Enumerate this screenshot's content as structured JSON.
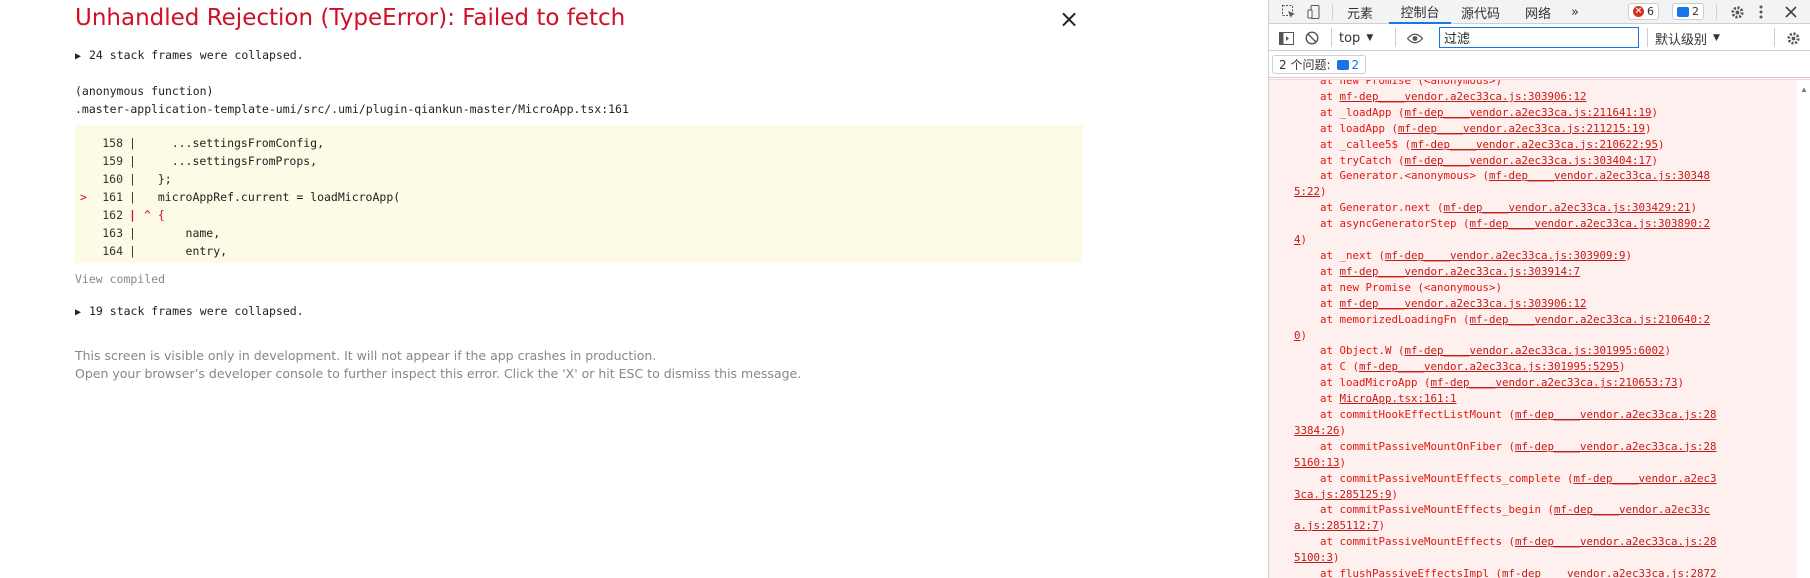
{
  "overlay": {
    "title": "Unhandled Rejection (TypeError): Failed to fetch",
    "close_glyph": "×",
    "collapsed_top": "24 stack frames were collapsed.",
    "function_name": "(anonymous function)",
    "file_path": ".master-application-template-umi/src/.umi/plugin-qiankun-master/MicroApp.tsx:161",
    "code_lines": [
      {
        "num": "158",
        "code": "    ...settingsFromConfig,",
        "highlight": false,
        "marker": ""
      },
      {
        "num": "159",
        "code": "    ...settingsFromProps,",
        "highlight": false,
        "marker": ""
      },
      {
        "num": "160",
        "code": "  };",
        "highlight": false,
        "marker": ""
      },
      {
        "num": "161",
        "code": "  microAppRef.current = loadMicroApp(",
        "highlight": true,
        "marker": ">"
      },
      {
        "num": "162",
        "code": "^ {",
        "highlight": true,
        "marker": ""
      },
      {
        "num": "163",
        "code": "      name,",
        "highlight": false,
        "marker": ""
      },
      {
        "num": "164",
        "code": "      entry,",
        "highlight": false,
        "marker": ""
      }
    ],
    "view_compiled": "View compiled",
    "collapsed_bottom": "19 stack frames were collapsed.",
    "footer_line1": "This screen is visible only in development. It will not appear if the app crashes in production.",
    "footer_line2": "Open your browser’s developer console to further inspect this error.  Click the 'X' or hit ESC to dismiss this message."
  },
  "devtools": {
    "tabs": {
      "elements": "元素",
      "console": "控制台",
      "sources": "源代码",
      "network": "网络",
      "more": "»"
    },
    "error_count": "6",
    "message_count": "2",
    "context": "top",
    "filter_value": "过滤",
    "levels": "默认级别",
    "issues_label": "2 个问题:",
    "issues_count": "2",
    "console_lines": [
      {
        "pre": "    at new Promise (<anonymous>)",
        "link": "",
        "post": ""
      },
      {
        "pre": "    at ",
        "link": "mf-dep____vendor.a2ec33ca.js:303906:12",
        "post": ""
      },
      {
        "pre": "    at _loadApp (",
        "link": "mf-dep____vendor.a2ec33ca.js:211641:19",
        "post": ")"
      },
      {
        "pre": "    at loadApp (",
        "link": "mf-dep____vendor.a2ec33ca.js:211215:19",
        "post": ")"
      },
      {
        "pre": "    at _callee5$ (",
        "link": "mf-dep____vendor.a2ec33ca.js:210622:95",
        "post": ")"
      },
      {
        "pre": "    at tryCatch (",
        "link": "mf-dep____vendor.a2ec33ca.js:303404:17",
        "post": ")"
      },
      {
        "pre": "    at Generator.<anonymous> (",
        "link": "mf-dep____vendor.a2ec33ca.js:30348",
        "post": ""
      },
      {
        "pre": "",
        "link": "5:22",
        "post": ")"
      },
      {
        "pre": "    at Generator.next (",
        "link": "mf-dep____vendor.a2ec33ca.js:303429:21",
        "post": ")"
      },
      {
        "pre": "    at asyncGeneratorStep (",
        "link": "mf-dep____vendor.a2ec33ca.js:303890:2",
        "post": ""
      },
      {
        "pre": "",
        "link": "4",
        "post": ")"
      },
      {
        "pre": "    at _next (",
        "link": "mf-dep____vendor.a2ec33ca.js:303909:9",
        "post": ")"
      },
      {
        "pre": "    at ",
        "link": "mf-dep____vendor.a2ec33ca.js:303914:7",
        "post": ""
      },
      {
        "pre": "    at new Promise (<anonymous>)",
        "link": "",
        "post": ""
      },
      {
        "pre": "    at ",
        "link": "mf-dep____vendor.a2ec33ca.js:303906:12",
        "post": ""
      },
      {
        "pre": "    at memorizedLoadingFn (",
        "link": "mf-dep____vendor.a2ec33ca.js:210640:2",
        "post": ""
      },
      {
        "pre": "",
        "link": "0",
        "post": ")"
      },
      {
        "pre": "    at Object.W (",
        "link": "mf-dep____vendor.a2ec33ca.js:301995:6002",
        "post": ")"
      },
      {
        "pre": "    at C (",
        "link": "mf-dep____vendor.a2ec33ca.js:301995:5295",
        "post": ")"
      },
      {
        "pre": "    at loadMicroApp (",
        "link": "mf-dep____vendor.a2ec33ca.js:210653:73",
        "post": ")"
      },
      {
        "pre": "    at ",
        "link": "MicroApp.tsx:161:1",
        "post": ""
      },
      {
        "pre": "    at commitHookEffectListMount (",
        "link": "mf-dep____vendor.a2ec33ca.js:28",
        "post": ""
      },
      {
        "pre": "",
        "link": "3384:26",
        "post": ")"
      },
      {
        "pre": "    at commitPassiveMountOnFiber (",
        "link": "mf-dep____vendor.a2ec33ca.js:28",
        "post": ""
      },
      {
        "pre": "",
        "link": "5160:13",
        "post": ")"
      },
      {
        "pre": "    at commitPassiveMountEffects_complete (",
        "link": "mf-dep____vendor.a2ec3",
        "post": ""
      },
      {
        "pre": "",
        "link": "3ca.js:285125:9",
        "post": ")"
      },
      {
        "pre": "    at commitPassiveMountEffects_begin (",
        "link": "mf-dep____vendor.a2ec33c",
        "post": ""
      },
      {
        "pre": "",
        "link": "a.js:285112:7",
        "post": ")"
      },
      {
        "pre": "    at commitPassiveMountEffects (",
        "link": "mf-dep____vendor.a2ec33ca.js:28",
        "post": ""
      },
      {
        "pre": "",
        "link": "5100:3",
        "post": ")"
      },
      {
        "pre": "    at flushPassiveEffectsImpl (",
        "link": "mf-dep____vendor.a2ec33ca.js:2872",
        "post": ""
      }
    ],
    "colors": {
      "error_text": "#e3170d",
      "error_bg": "#fff0f0",
      "accent": "#1a73e8",
      "overlay_title": "#ce1126",
      "code_bg": "#fdfbe6"
    }
  }
}
